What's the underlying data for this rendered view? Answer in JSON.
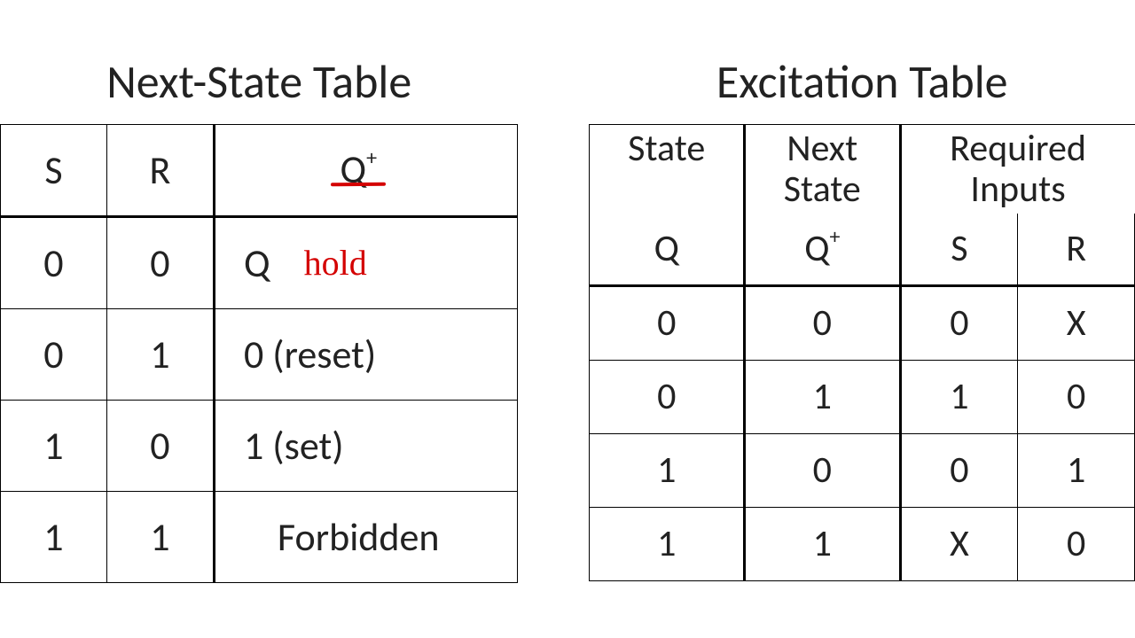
{
  "left": {
    "title": "Next-State Table",
    "headers": {
      "s": "S",
      "r": "R",
      "qplus_Q": "Q",
      "qplus_plus": "+"
    },
    "rows": [
      {
        "s": "0",
        "r": "0",
        "q": "Q",
        "note": "hold"
      },
      {
        "s": "0",
        "r": "1",
        "q": "0 (reset)",
        "note": ""
      },
      {
        "s": "1",
        "r": "0",
        "q": "1 (set)",
        "note": ""
      },
      {
        "s": "1",
        "r": "1",
        "q": "Forbidden",
        "note": ""
      }
    ]
  },
  "right": {
    "title": "Excitation Table",
    "headers": {
      "state": "State",
      "next_state_line1": "Next",
      "next_state_line2": "State",
      "required_line1": "Required",
      "required_line2": "Inputs",
      "q": "Q",
      "qplus_Q": "Q",
      "qplus_plus": "+",
      "s": "S",
      "r": "R"
    },
    "rows": [
      {
        "q": "0",
        "qp": "0",
        "s": "0",
        "r": "X"
      },
      {
        "q": "0",
        "qp": "1",
        "s": "1",
        "r": "0"
      },
      {
        "q": "1",
        "qp": "0",
        "s": "0",
        "r": "1"
      },
      {
        "q": "1",
        "qp": "1",
        "s": "X",
        "r": "0"
      }
    ]
  },
  "chart_data": [
    {
      "type": "table",
      "title": "Next-State Table",
      "columns": [
        "S",
        "R",
        "Q+"
      ],
      "rows": [
        [
          "0",
          "0",
          "Q (hold)"
        ],
        [
          "0",
          "1",
          "0 (reset)"
        ],
        [
          "1",
          "0",
          "1 (set)"
        ],
        [
          "1",
          "1",
          "Forbidden"
        ]
      ]
    },
    {
      "type": "table",
      "title": "Excitation Table",
      "columns": [
        "Q (State)",
        "Q+ (Next State)",
        "S (Required Input)",
        "R (Required Input)"
      ],
      "rows": [
        [
          "0",
          "0",
          "0",
          "X"
        ],
        [
          "0",
          "1",
          "1",
          "0"
        ],
        [
          "1",
          "0",
          "0",
          "1"
        ],
        [
          "1",
          "1",
          "X",
          "0"
        ]
      ]
    }
  ]
}
